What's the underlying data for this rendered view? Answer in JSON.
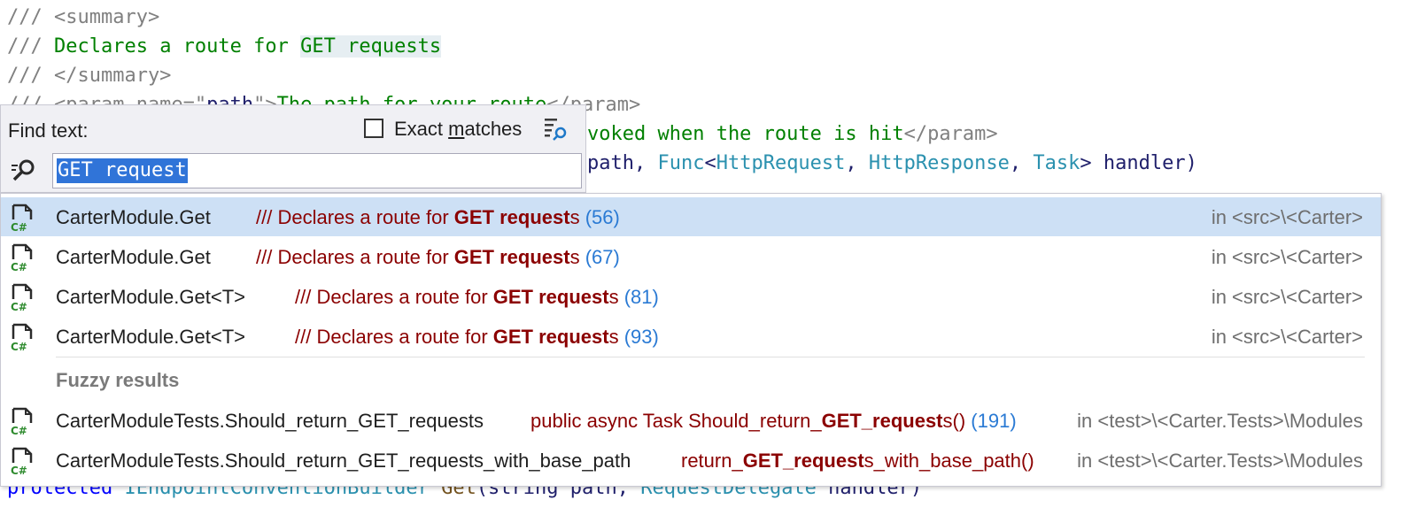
{
  "code": {
    "line1": "/// <summary>",
    "line2_prefix": "/// ",
    "line2_text_a": "Declares a route for ",
    "line2_text_hl": "GET requests",
    "line3": "/// </summary>",
    "line4_prefix": "/// <param name=\"",
    "line4_name": "path",
    "line4_mid": "\">",
    "line4_text": "The path for your route",
    "line4_end": "</param>",
    "line5_text": "voked when the route is hit",
    "line5_end": "</param>",
    "line6_a": "path, ",
    "line6_func": "Func",
    "line6_lt": "<",
    "line6_t1": "HttpRequest",
    "line6_c1": ", ",
    "line6_t2": "HttpResponse",
    "line6_c2": ", ",
    "line6_t3": "Task",
    "line6_gt": "> handler)",
    "bottom_a": "protected ",
    "bottom_type": "IEndpointConventionBuilder",
    "bottom_method": " Get",
    "bottom_b": "(string path, ",
    "bottom_type2": "RequestDelegate",
    "bottom_c": " handler)"
  },
  "find": {
    "label": "Find text:",
    "exact_matches_pre": "Exact ",
    "exact_matches_u": "m",
    "exact_matches_post": "atches",
    "exact_checked": false,
    "query": "GET request"
  },
  "results": [
    {
      "name": "CarterModule.Get",
      "snip_pre": "/// Declares a route for ",
      "snip_bold": "GET request",
      "snip_post": "s",
      "line": "(56)",
      "loc": "in <src>\\<Carter>",
      "selected": true
    },
    {
      "name": "CarterModule.Get",
      "snip_pre": "/// Declares a route for ",
      "snip_bold": "GET request",
      "snip_post": "s",
      "line": "(67)",
      "loc": "in <src>\\<Carter>",
      "selected": false
    },
    {
      "name": "CarterModule.Get<T>",
      "snip_pre": "/// Declares a route for ",
      "snip_bold": "GET request",
      "snip_post": "s",
      "line": "(81)",
      "loc": "in <src>\\<Carter>",
      "selected": false
    },
    {
      "name": "CarterModule.Get<T>",
      "snip_pre": "/// Declares a route for ",
      "snip_bold": "GET request",
      "snip_post": "s",
      "line": "(93)",
      "loc": "in <src>\\<Carter>",
      "selected": false
    }
  ],
  "fuzzy_label": "Fuzzy results",
  "fuzzy_results": [
    {
      "name": "CarterModuleTests.Should_return_GET_requests",
      "snip_pre": "public async Task Should_return_",
      "snip_bold": "GET_request",
      "snip_post": "s()",
      "line": "(191)",
      "loc": "in <test>\\<Carter.Tests>\\Modules"
    },
    {
      "name": "CarterModuleTests.Should_return_GET_requests_with_base_path",
      "snip_pre": "return_",
      "snip_bold": "GET_request",
      "snip_post": "s_with_base_path()",
      "line": "",
      "loc": "in <test>\\<Carter.Tests>\\Modules"
    }
  ],
  "icons": {
    "file": "csharp-file-icon",
    "search": "search-icon",
    "options": "search-options-icon"
  }
}
